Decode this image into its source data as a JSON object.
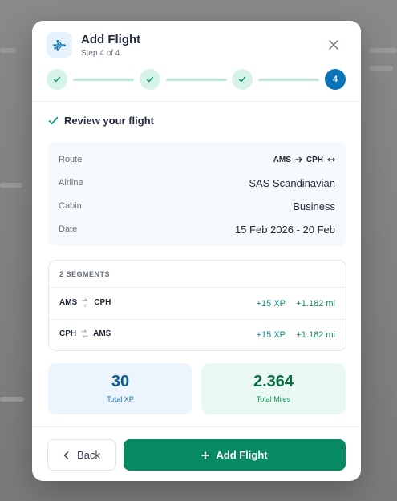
{
  "modal": {
    "title": "Add Flight",
    "step_text": "Step 4 of 4",
    "icons": {
      "header": "airplane-icon",
      "close": "close-icon"
    }
  },
  "stepper": {
    "steps": [
      {
        "state": "done",
        "icon": "check-icon"
      },
      {
        "state": "done",
        "icon": "check-icon"
      },
      {
        "state": "done",
        "icon": "check-icon"
      },
      {
        "state": "active",
        "label": "4"
      }
    ]
  },
  "review": {
    "heading": "Review your flight",
    "heading_icon": "check-icon"
  },
  "summary": {
    "route_label": "Route",
    "route_from": "AMS",
    "route_to": "CPH",
    "route_round_trip_icon": "round-trip-icon",
    "airline_label": "Airline",
    "airline_value": "SAS Scandinavian",
    "cabin_label": "Cabin",
    "cabin_value": "Business",
    "date_label": "Date",
    "date_value": "15 Feb 2026 - 20 Feb"
  },
  "segments": {
    "header": "2 SEGMENTS",
    "items": [
      {
        "from": "AMS",
        "to": "CPH",
        "xp": "+15 XP",
        "miles": "+1.182 mi"
      },
      {
        "from": "CPH",
        "to": "AMS",
        "xp": "+15 XP",
        "miles": "+1.182 mi"
      }
    ]
  },
  "totals": {
    "xp_value": "30",
    "xp_label": "Total XP",
    "miles_value": "2.364",
    "miles_label": "Total Miles"
  },
  "footer": {
    "back_label": "Back",
    "add_label": "Add Flight"
  },
  "colors": {
    "primary": "#0b73b8",
    "success": "#078a63",
    "accent_teal": "#0f8f8a",
    "step_done_bg": "#d6f3e7"
  }
}
